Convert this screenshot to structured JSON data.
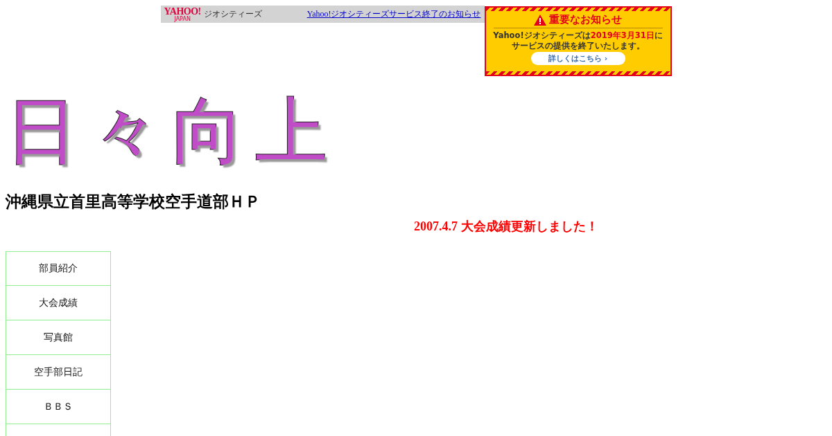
{
  "geocities_bar": {
    "logo": "YAHOO!",
    "logo_sub": "JAPAN",
    "service": "ジオシティーズ",
    "link": "Yahoo!ジオシティーズサービス終了のお知らせ"
  },
  "notice_banner": {
    "title": "重要なお知らせ",
    "message": [
      {
        "text": "Yahoo!ジオシティーズは",
        "emphasis": false
      },
      {
        "text": "2019年3月31日",
        "emphasis": true
      },
      {
        "text": "に",
        "emphasis": false
      }
    ],
    "message_line_2": "サービスの提供を終了いたします。",
    "button": "詳しくはこちら ›"
  },
  "site_title": "日々向上",
  "heading": "沖縄県立首里高等学校空手道部ＨＰ",
  "update_notice": "2007.4.7 大会成績更新しました！",
  "nav": {
    "items": [
      {
        "label": "部員紹介"
      },
      {
        "label": "大会成績"
      },
      {
        "label": "写真館"
      },
      {
        "label": "空手部日記"
      },
      {
        "label": "ＢＢＳ"
      }
    ]
  }
}
